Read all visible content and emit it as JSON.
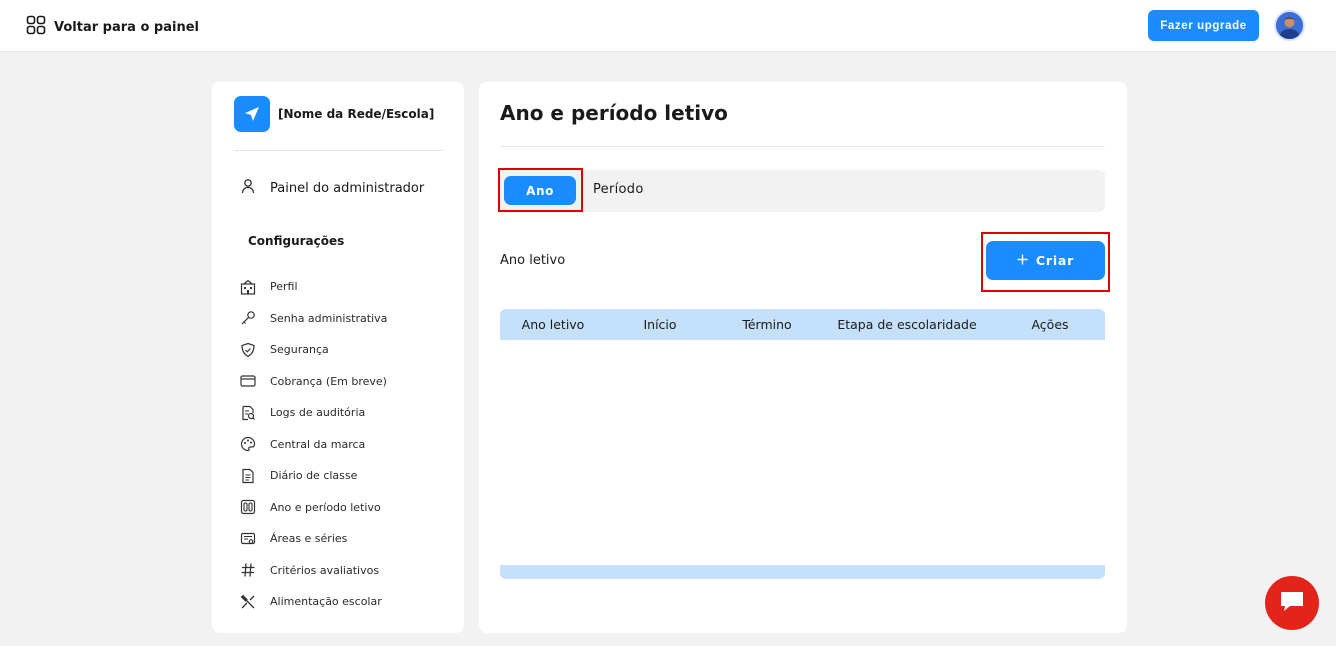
{
  "topbar": {
    "back_label": "Voltar para o painel",
    "upgrade_label": "Fazer upgrade",
    "accent_color": "#1a8cff"
  },
  "sidebar": {
    "brand_name": "[Nome da Rede/Escola]",
    "admin_label": "Painel do administrador",
    "section_title": "Configurações",
    "items": [
      {
        "label": "Perfil",
        "icon": "profile-building-icon"
      },
      {
        "label": "Senha administrativa",
        "icon": "key-icon"
      },
      {
        "label": "Segurança",
        "icon": "shield-icon"
      },
      {
        "label": "Cobrança (Em breve)",
        "icon": "card-icon"
      },
      {
        "label": "Logs de auditória",
        "icon": "audit-log-icon"
      },
      {
        "label": "Central da marca",
        "icon": "palette-icon"
      },
      {
        "label": "Diário de classe",
        "icon": "document-icon"
      },
      {
        "label": "Ano e período letivo",
        "icon": "calendar-period-icon"
      },
      {
        "label": "Áreas e séries",
        "icon": "certificate-icon"
      },
      {
        "label": "Critérios avaliativos",
        "icon": "hash-icon"
      },
      {
        "label": "Alimentação escolar",
        "icon": "utensils-icon"
      }
    ]
  },
  "main": {
    "title": "Ano e período letivo",
    "tabs": [
      {
        "label": "Ano",
        "active": true
      },
      {
        "label": "Período",
        "active": false
      }
    ],
    "section_label": "Ano letivo",
    "create_label": "Criar",
    "table": {
      "columns": [
        "Ano letivo",
        "Início",
        "Término",
        "Etapa de escolaridade",
        "Ações"
      ],
      "rows": []
    },
    "header_color": "#c4e0fb",
    "highlight_color": "#e00000"
  },
  "chat": {
    "icon": "chat-bubble-icon",
    "color": "#e3241b"
  }
}
